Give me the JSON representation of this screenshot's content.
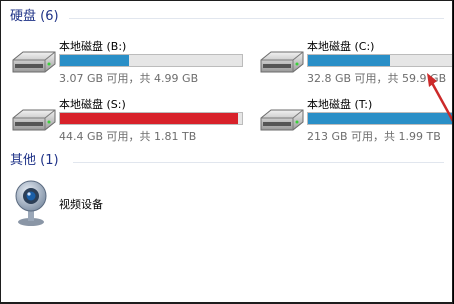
{
  "groups": {
    "hard_disks": {
      "title": "硬盘 (6)"
    },
    "other": {
      "title": "其他 (1)"
    }
  },
  "drives": [
    {
      "name": "本地磁盘 (B:)",
      "info": "3.07 GB 可用，共 4.99 GB",
      "used_fraction": 0.38,
      "bar_color": "#2a8fc7"
    },
    {
      "name": "本地磁盘 (C:)",
      "info": "32.8 GB 可用，共 59.9 GB",
      "used_fraction": 0.45,
      "bar_color": "#2a8fc7"
    },
    {
      "name": "本地磁盘 (S:)",
      "info": "44.4 GB 可用，共 1.81 TB",
      "used_fraction": 0.98,
      "bar_color": "#d8212a"
    },
    {
      "name": "本地磁盘 (T:)",
      "info": "213 GB 可用，共 1.99 TB",
      "used_fraction": 0.9,
      "bar_color": "#2a8fc7"
    }
  ],
  "device": {
    "label": "视频设备",
    "icon": "webcam-icon"
  },
  "annotation": {
    "arrow_color": "#cc2a2a"
  }
}
